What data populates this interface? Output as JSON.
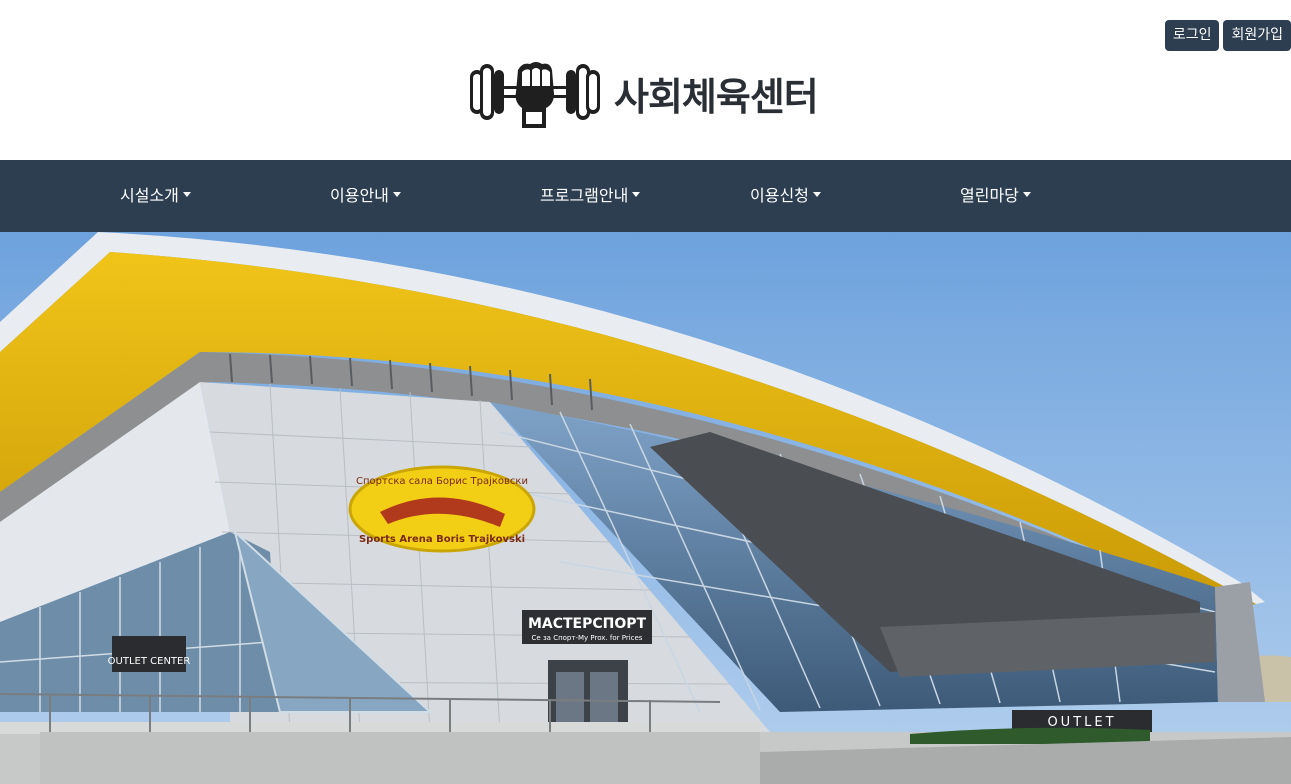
{
  "auth": {
    "login_label": "로그인",
    "signup_label": "회원가입"
  },
  "logo": {
    "text": "사회체육센터",
    "icon": "dumbbell-fist-icon"
  },
  "nav": {
    "items": [
      {
        "label": "시설소개"
      },
      {
        "label": "이용안내"
      },
      {
        "label": "프로그램안내"
      },
      {
        "label": "이용신청"
      },
      {
        "label": "열린마당"
      }
    ]
  },
  "hero": {
    "sign_top": "Спортска сала Борис Трајковски",
    "sign_bottom": "Sports Arena Boris Trajkovski",
    "store_sign": "МАСТЕРСПОРТ",
    "store_sub": "Се за Спорт-Му Prox. for Prices",
    "outlet_center": "OUTLET CENTER",
    "outlet": "OUTLET"
  },
  "colors": {
    "nav_bg": "#2c3e50",
    "button_bg": "#2c3e50",
    "roof_yellow": "#e0b10c",
    "sky": "#8fb8e6"
  }
}
